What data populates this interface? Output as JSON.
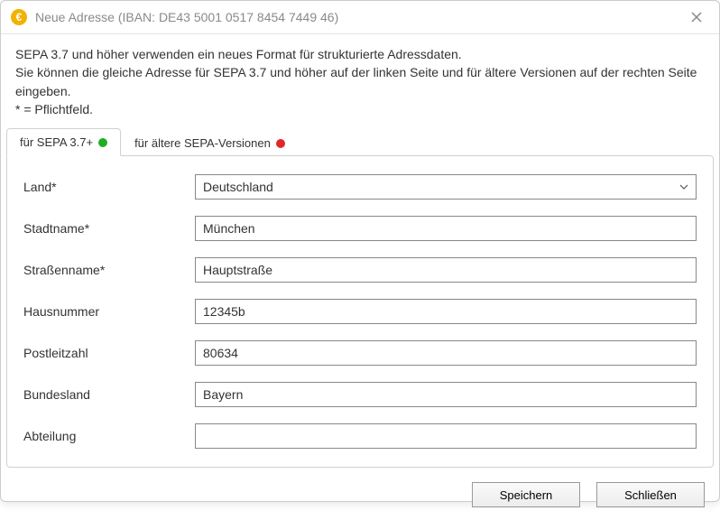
{
  "window": {
    "title": "Neue Adresse (IBAN: DE43 5001 0517 8454 7449 46)"
  },
  "intro": {
    "line1": "SEPA 3.7 und höher verwenden ein neues Format für strukturierte Adressdaten.",
    "line2": "Sie können die gleiche Adresse für SEPA 3.7 und höher auf der linken Seite und für ältere Versionen auf der rechten Seite eingeben.",
    "line3": "* = Pflichtfeld."
  },
  "tabs": {
    "sepa37": "für SEPA 3.7+",
    "older": "für ältere SEPA-Versionen"
  },
  "form": {
    "country": {
      "label": "Land*",
      "value": "Deutschland"
    },
    "city": {
      "label": "Stadtname*",
      "value": "München"
    },
    "street": {
      "label": "Straßenname*",
      "value": "Hauptstraße"
    },
    "houseno": {
      "label": "Hausnummer",
      "value": "12345b"
    },
    "postal": {
      "label": "Postleitzahl",
      "value": "80634"
    },
    "state": {
      "label": "Bundesland",
      "value": "Bayern"
    },
    "department": {
      "label": "Abteilung",
      "value": ""
    }
  },
  "footer": {
    "save": "Speichern",
    "close": "Schließen"
  }
}
